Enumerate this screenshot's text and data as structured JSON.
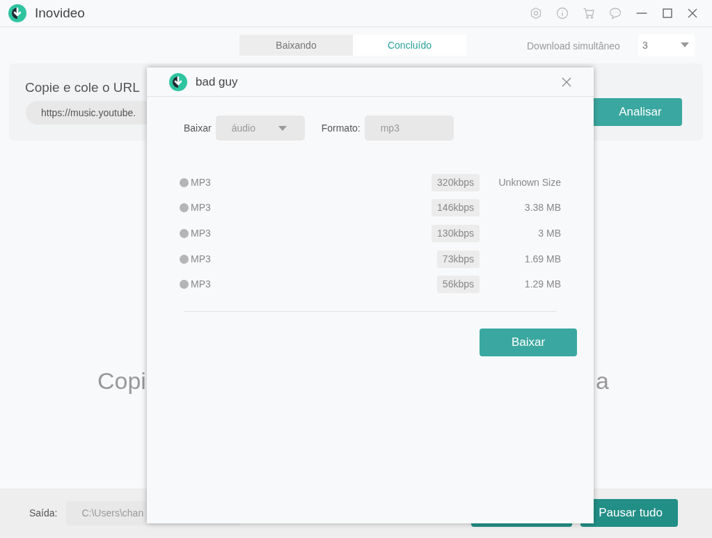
{
  "window": {
    "title": "Inovideo"
  },
  "tabs": [
    {
      "label": "Baixando",
      "selected": false
    },
    {
      "label": "Concluído",
      "selected": true
    }
  ],
  "simultaneous": {
    "label": "Download simultâneo",
    "value": "3"
  },
  "url_panel": {
    "title": "Copie e cole o URL",
    "url": "https://music.youtube.",
    "button": "Analisar"
  },
  "hint": {
    "left": "Copi",
    "right": "a"
  },
  "footer": {
    "label": "Saída:",
    "path": "C:\\Users\\chan",
    "button": "Pausar tudo"
  },
  "dialog": {
    "title": "bad guy",
    "download_label": "Baixar",
    "download_type": "áudio",
    "format_label": "Formato:",
    "format": "mp3",
    "options": [
      {
        "name": "MP3",
        "bitrate": "320kbps",
        "size": "Unknown Size",
        "selected": false
      },
      {
        "name": "MP3",
        "bitrate": "146kbps",
        "size": "3.38 MB",
        "selected": false
      },
      {
        "name": "MP3",
        "bitrate": "130kbps",
        "size": "3 MB",
        "selected": false
      },
      {
        "name": "MP3",
        "bitrate": "73kbps",
        "size": "1.69 MB",
        "selected": false
      },
      {
        "name": "MP3",
        "bitrate": "56kbps",
        "size": "1.29 MB",
        "selected": false
      }
    ],
    "button": "Baixar"
  }
}
